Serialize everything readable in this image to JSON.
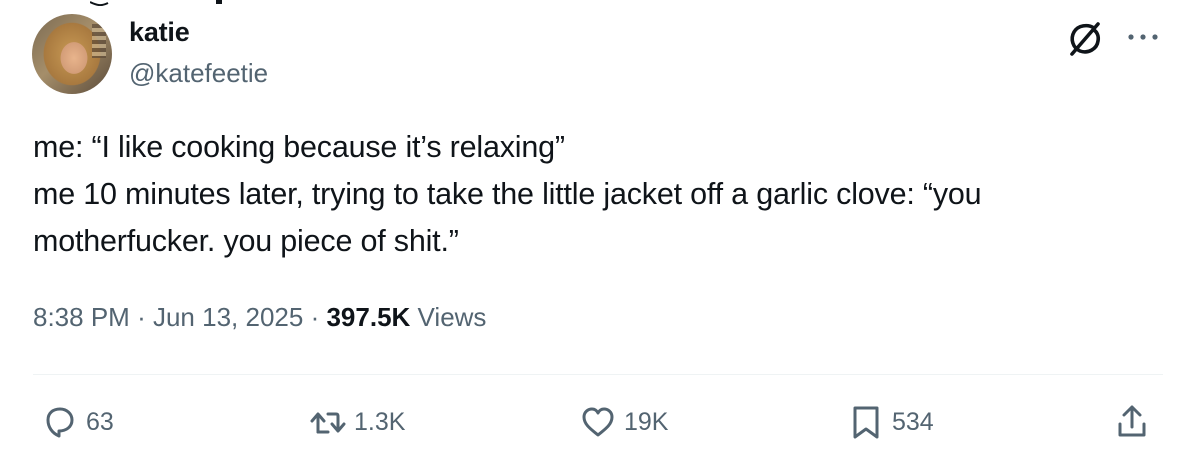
{
  "author": {
    "display_name": "katie",
    "handle": "@katefeetie"
  },
  "tweet": {
    "lines": [
      "me: “I like cooking because it’s relaxing”",
      "me 10 minutes later, trying to take the little jacket off a garlic clove: “you",
      "motherfucker. you piece of shit.”"
    ]
  },
  "meta": {
    "time": "8:38 PM",
    "separator": "·",
    "date": "Jun 13, 2025",
    "views_count": "397.5K",
    "views_label": "Views"
  },
  "actions": {
    "replies": "63",
    "reposts": "1.3K",
    "likes": "19K",
    "bookmarks": "534"
  },
  "icons": {
    "header": [
      "grok-icon",
      "more-options-icon"
    ],
    "actions": [
      "reply-icon",
      "repost-icon",
      "like-icon",
      "bookmark-icon",
      "share-icon"
    ]
  },
  "colors": {
    "text_primary": "#0f1419",
    "text_secondary": "#536471",
    "divider": "#eff3f4"
  }
}
